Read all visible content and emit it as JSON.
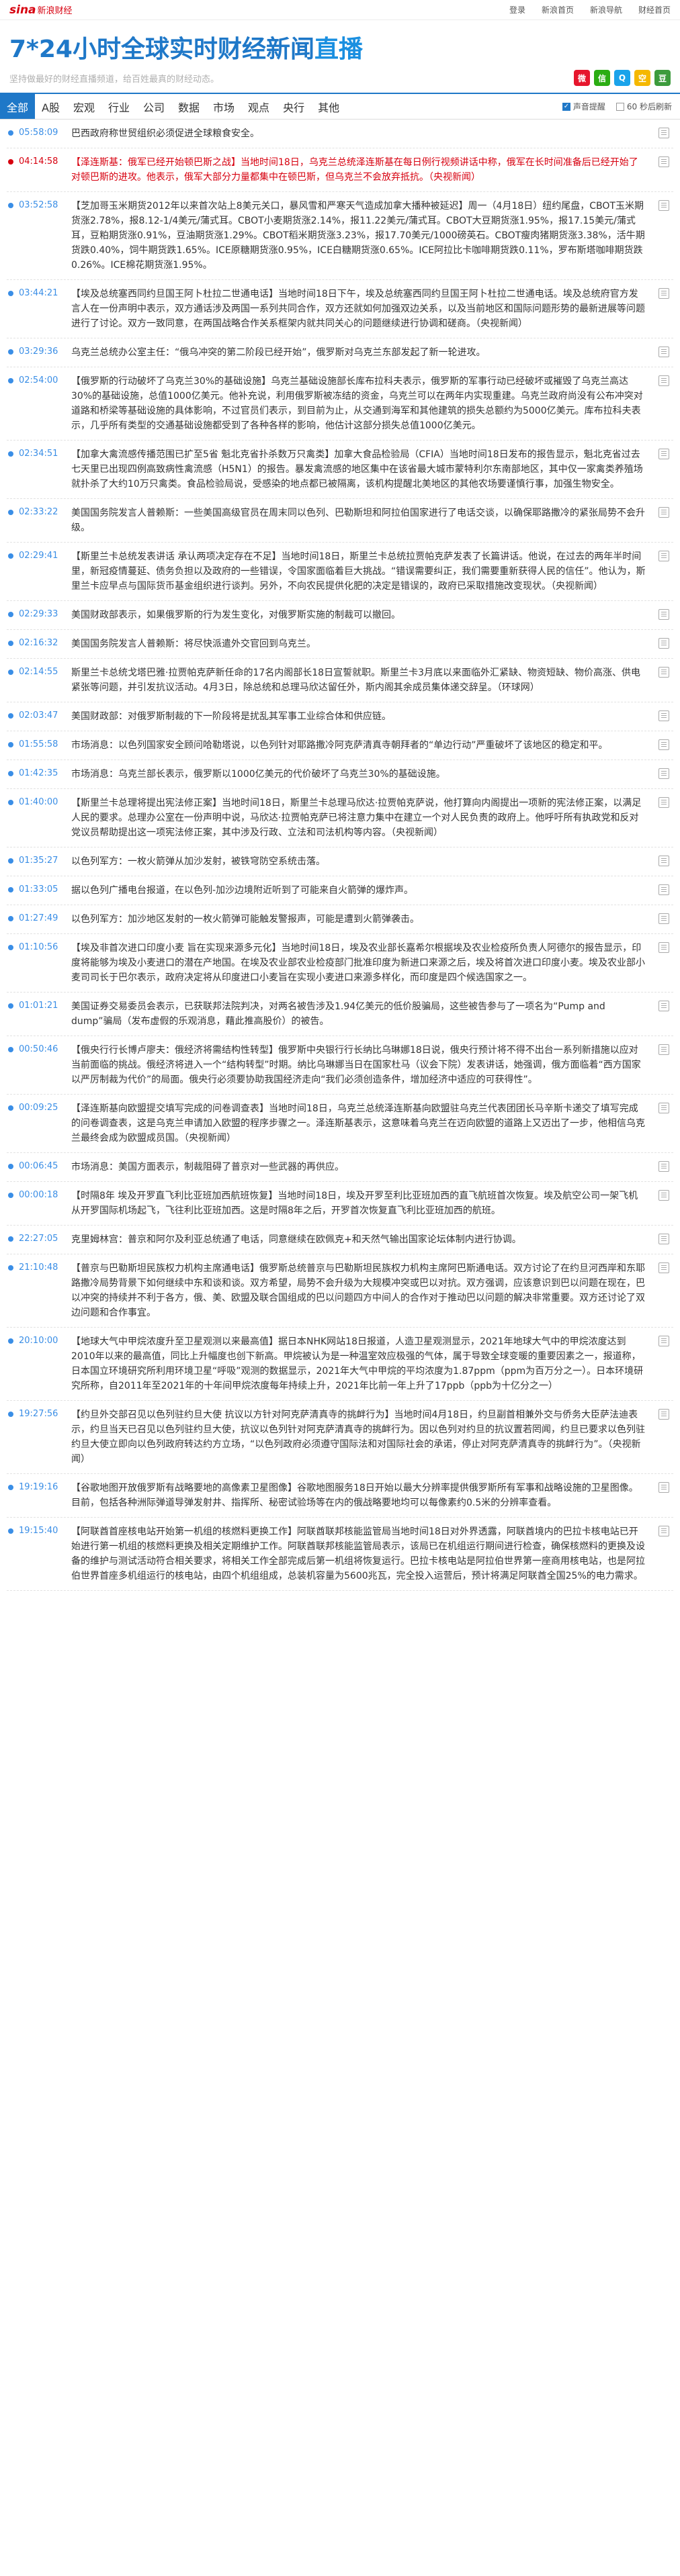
{
  "top": {
    "logo": "sina",
    "logo_sub": "新浪财经",
    "links": [
      "登录",
      "新浪首页",
      "新浪导航",
      "财经首页"
    ]
  },
  "header": {
    "title_main": "7*24小时全球实时财经新闻",
    "title_highlight": "直播",
    "slogan": "坚持做最好的财经直播频道，给百姓最真的财经动态。",
    "share_icons": [
      "weibo-icon",
      "wechat-icon",
      "qq-icon",
      "qzone-icon",
      "douban-icon"
    ]
  },
  "nav": {
    "tabs": [
      "全部",
      "A股",
      "宏观",
      "行业",
      "公司",
      "数据",
      "市场",
      "观点",
      "央行",
      "其他"
    ],
    "active": 0,
    "sound_label": "声音提醒",
    "refresh_label": "60 秒后刷新",
    "refresh_value": "60"
  },
  "colors": {
    "accent": "#1f78c8",
    "alert": "#d7000f",
    "time": "#3a8ee6"
  },
  "feed": [
    {
      "time": "05:58:09",
      "alert": false,
      "text": "巴西政府称世贸组织必须促进全球粮食安全。"
    },
    {
      "time": "04:14:58",
      "alert": true,
      "text": "【泽连斯基：俄军已经开始顿巴斯之战】当地时间18日，乌克兰总统泽连斯基在每日例行视频讲话中称，俄军在长时间准备后已经开始了对顿巴斯的进攻。他表示，俄军大部分力量都集中在顿巴斯，但乌克兰不会放弃抵抗。（央视新闻）"
    },
    {
      "time": "03:52:58",
      "alert": false,
      "text": "【芝加哥玉米期货2012年以来首次站上8美元关口，暴风雪和严寒天气造成加拿大播种被延迟】周一（4月18日）纽约尾盘，CBOT玉米期货涨2.78%，报8.12-1/4美元/蒲式耳。CBOT小麦期货涨2.14%，报11.22美元/蒲式耳。CBOT大豆期货涨1.95%，报17.15美元/蒲式耳，豆粕期货涨0.91%，豆油期货涨1.29%。CBOT稻米期货涨3.23%，报17.70美元/1000磅英石。CBOT瘦肉猪期货涨3.38%，活牛期货跌0.40%，饲牛期货跌1.65%。ICE原糖期货涨0.95%，ICE白糖期货涨0.65%。ICE阿拉比卡咖啡期货跌0.11%，罗布斯塔咖啡期货跌0.26%。ICE棉花期货涨1.95%。"
    },
    {
      "time": "03:44:21",
      "alert": false,
      "text": "【埃及总统塞西同约旦国王阿卜杜拉二世通电话】当地时间18日下午，埃及总统塞西同约旦国王阿卜杜拉二世通电话。埃及总统府官方发言人在一份声明中表示，双方通话涉及两国一系列共同合作，双方还就如何加强双边关系，以及当前地区和国际问题形势的最新进展等问题进行了讨论。双方一致同意，在两国战略合作关系框架内就共同关心的问题继续进行协调和磋商。（央视新闻）"
    },
    {
      "time": "03:29:36",
      "alert": false,
      "text": "乌克兰总统办公室主任：“俄乌冲突的第二阶段已经开始”，俄罗斯对乌克兰东部发起了新一轮进攻。"
    },
    {
      "time": "02:54:00",
      "alert": false,
      "text": "【俄罗斯的行动破坏了乌克兰30%的基础设施】乌克兰基础设施部长库布拉科夫表示，俄罗斯的军事行动已经破坏或摧毁了乌克兰高达30%的基础设施，总值1000亿美元。他补充说，利用俄罗斯被冻结的资金，乌克兰可以在两年内实现重建。乌克兰政府尚没有公布冲突对道路和桥梁等基础设施的具体影响，不过官员们表示，到目前为止，从交通到海军和其他建筑的损失总额约为5000亿美元。库布拉科夫表示，几乎所有类型的交通基础设施都受到了各种各样的影响，他估计这部分损失总值1000亿美元。"
    },
    {
      "time": "02:34:51",
      "alert": false,
      "text": "【加拿大禽流感传播范围已扩至5省 魁北克省扑杀数万只禽类】加拿大食品检验局（CFIA）当地时间18日发布的报告显示，魁北克省过去七天里已出现四例高致病性禽流感（H5N1）的报告。暴发禽流感的地区集中在该省最大城市蒙特利尔东南部地区，其中仅一家禽类养殖场就扑杀了大约10万只禽类。食品检验局说，受感染的地点都已被隔离，该机构提醒北美地区的其他农场要谨慎行事，加强生物安全。"
    },
    {
      "time": "02:33:22",
      "alert": false,
      "text": "美国国务院发言人普赖斯：一些美国高级官员在周末同以色列、巴勒斯坦和阿拉伯国家进行了电话交谈，以确保耶路撒冷的紧张局势不会升级。"
    },
    {
      "time": "02:29:41",
      "alert": false,
      "text": "【斯里兰卡总统发表讲话 承认两项决定存在不足】当地时间18日，斯里兰卡总统拉贾帕克萨发表了长篇讲话。他说，在过去的两年半时间里，新冠疫情蔓延、债务负担以及政府的一些错误，令国家面临着巨大挑战。“错误需要纠正，我们需要重新获得人民的信任”。他认为，斯里兰卡应早点与国际货币基金组织进行谈判。另外，不向农民提供化肥的决定是错误的，政府已采取措施改变现状。（央视新闻）"
    },
    {
      "time": "02:29:33",
      "alert": false,
      "text": "美国财政部表示，如果俄罗斯的行为发生变化，对俄罗斯实施的制裁可以撤回。"
    },
    {
      "time": "02:16:32",
      "alert": false,
      "text": "美国国务院发言人普赖斯：将尽快派遣外交官回到乌克兰。"
    },
    {
      "time": "02:14:55",
      "alert": false,
      "text": "斯里兰卡总统戈塔巴雅·拉贾帕克萨新任命的17名内阁部长18日宣誓就职。斯里兰卡3月底以来面临外汇紧缺、物资短缺、物价高涨、供电紧张等问题，并引发抗议活动。4月3日，除总统和总理马欣达留任外，斯内阁其余成员集体递交辞呈。（环球网）"
    },
    {
      "time": "02:03:47",
      "alert": false,
      "text": "美国财政部：对俄罗斯制裁的下一阶段将是扰乱其军事工业综合体和供应链。"
    },
    {
      "time": "01:55:58",
      "alert": false,
      "text": "市场消息：以色列国家安全顾问哈勒塔说，以色列针对耶路撒冷阿克萨清真寺朝拜者的“单边行动”严重破坏了该地区的稳定和平。"
    },
    {
      "time": "01:42:35",
      "alert": false,
      "text": "市场消息：乌克兰部长表示，俄罗斯以1000亿美元的代价破坏了乌克兰30%的基础设施。"
    },
    {
      "time": "01:40:00",
      "alert": false,
      "text": "【斯里兰卡总理将提出宪法修正案】当地时间18日，斯里兰卡总理马欣达·拉贾帕克萨说，他打算向内阁提出一项新的宪法修正案，以满足人民的要求。总理办公室在一份声明中说，马欣达·拉贾帕克萨已将注意力集中在建立一个对人民负责的政府上。他呼吁所有执政党和反对党议员帮助提出这一项宪法修正案，其中涉及行政、立法和司法机构等内容。（央视新闻）"
    },
    {
      "time": "01:35:27",
      "alert": false,
      "text": "以色列军方：一枚火箭弹从加沙发射，被铁穹防空系统击落。"
    },
    {
      "time": "01:33:05",
      "alert": false,
      "text": "据以色列广播电台报道，在以色列-加沙边境附近听到了可能来自火箭弹的爆炸声。"
    },
    {
      "time": "01:27:49",
      "alert": false,
      "text": "以色列军方：加沙地区发射的一枚火箭弹可能触发警报声，可能是遭到火箭弹袭击。"
    },
    {
      "time": "01:10:56",
      "alert": false,
      "text": "【埃及非首次进口印度小麦 旨在实现来源多元化】当地时间18日，埃及农业部长嘉希尔根据埃及农业检疫所负责人阿德尔的报告显示，印度将能够为埃及小麦进口的潜在产地国。在埃及农业部农业检疫部门批准印度为新进口来源之后，埃及将首次进口印度小麦。埃及农业部小麦司司长于巴尔表示，政府决定将从印度进口小麦旨在实现小麦进口来源多样化，而印度是四个候选国家之一。"
    },
    {
      "time": "01:01:21",
      "alert": false,
      "text": "美国证券交易委员会表示，已获联邦法院判决，对两名被告涉及1.94亿美元的低价股骗局，这些被告参与了一项名为“Pump and dump”骗局（发布虚假的乐观消息，藉此推高股价）的被告。"
    },
    {
      "time": "00:50:46",
      "alert": false,
      "text": "【俄央行行长博卢廖夫：俄经济将需结构性转型】俄罗斯中央银行行长纳比乌琳娜18日说，俄央行预计将不得不出台一系列新措施以应对当前面临的挑战。俄经济将进入一个“结构转型”时期。纳比乌琳娜当日在国家杜马（议会下院）发表讲话，她强调，俄方面临着“西方国家以严厉制裁为代价”的局面。俄央行必须要协助我国经济走向“我们必须创造条件，增加经济中适应的可获得性”。"
    },
    {
      "time": "00:09:25",
      "alert": false,
      "text": "【泽连斯基向欧盟提交填写完成的问卷调查表】当地时间18日，乌克兰总统泽连斯基向欧盟驻乌克兰代表团团长马辛斯卡递交了填写完成的问卷调查表，这是乌克兰申请加入欧盟的程序步骤之一。泽连斯基表示，这意味着乌克兰在迈向欧盟的道路上又迈出了一步，他相信乌克兰最终会成为欧盟成员国。（央视新闻）"
    },
    {
      "time": "00:06:45",
      "alert": false,
      "text": "市场消息：美国方面表示，制裁阻碍了普京对一些武器的再供应。"
    },
    {
      "time": "00:00:18",
      "alert": false,
      "text": "【时隔8年 埃及开罗直飞利比亚班加西航班恢复】当地时间18日，埃及开罗至利比亚班加西的直飞航班首次恢复。埃及航空公司一架飞机从开罗国际机场起飞，飞往利比亚班加西。这是时隔8年之后，开罗首次恢复直飞利比亚班加西的航班。"
    },
    {
      "time": "22:27:05",
      "alert": false,
      "text": "克里姆林宫：普京和阿尔及利亚总统通了电话，同意继续在欧佩克+和天然气输出国家论坛体制内进行协调。"
    },
    {
      "time": "21:10:48",
      "alert": false,
      "text": "【普京与巴勒斯坦民族权力机构主席通电话】俄罗斯总统普京与巴勒斯坦民族权力机构主席阿巴斯通电话。双方讨论了在约旦河西岸和东耶路撒冷局势背景下如何继续中东和谈和谈。双方希望，局势不会升级为大规模冲突或巴以对抗。双方强调，应该意识到巴以问题在现在，巴以冲突的持续并不利于各方，俄、美、欧盟及联合国组成的巴以问题四方中间人的合作对于推动巴以问题的解决非常重要。双方还讨论了双边问题和合作事宜。"
    },
    {
      "time": "20:10:00",
      "alert": false,
      "text": "【地球大气中甲烷浓度升至卫星观测以来最高值】据日本NHK网站18日报道，人造卫星观测显示，2021年地球大气中的甲烷浓度达到2010年以来的最高值，同比上升幅度也创下新高。甲烷被认为是一种温室效应极强的气体，属于导致全球变暖的重要因素之一，报道称，日本国立环境研究所利用环境卫星“呼吸”观测的数据显示，2021年大气中甲烷的平均浓度为1.87ppm（ppm为百万分之一）。日本环境研究所称，自2011年至2021年的十年间甲烷浓度每年持续上升，2021年比前一年上升了17ppb（ppb为十亿分之一）"
    },
    {
      "time": "19:27:56",
      "alert": false,
      "text": "【约旦外交部召见以色列驻约旦大使 抗议以方针对阿克萨清真寺的挑衅行为】当地时间4月18日，约旦副首相兼外交与侨务大臣萨法迪表示，约旦当天已召见以色列驻约旦大使，抗议以色列针对阿克萨清真寺的挑衅行为。因以色列对约旦的抗议置若罔闻，约旦已要求以色列驻约旦大使立即向以色列政府转达约方立场，“以色列政府必须遵守国际法和对国际社会的承诺，停止对阿克萨清真寺的挑衅行为”。（央视新闻）"
    },
    {
      "time": "19:19:16",
      "alert": false,
      "text": "【谷歌地图开放俄罗斯有战略要地的高像素卫星图像】谷歌地图服务18日开始以最大分辨率提供俄罗斯所有军事和战略设施的卫星图像。目前，包括各种洲际弹道导弹发射井、指挥所、秘密试验场等在内的俄战略要地均可以每像素约0.5米的分辨率查看。"
    },
    {
      "time": "19:15:40",
      "alert": false,
      "text": "【阿联酋首座核电站开始第一机组的核燃料更换工作】阿联酋联邦核能监管局当地时间18日对外界透露，阿联酋境内的巴拉卡核电站已开始进行第一机组的核燃料更换及相关定期维护工作。阿联酋联邦核能监管局表示，该局已在机组运行期间进行检查，确保核燃料的更换及设备的维护与测试活动符合相关要求，将相关工作全部完成后第一机组将恢复运行。巴拉卡核电站是阿拉伯世界第一座商用核电站，也是阿拉伯世界首座多机组运行的核电站，由四个机组组成，总装机容量为5600兆瓦，完全投入运营后，预计将满足阿联酋全国25%的电力需求。"
    }
  ]
}
